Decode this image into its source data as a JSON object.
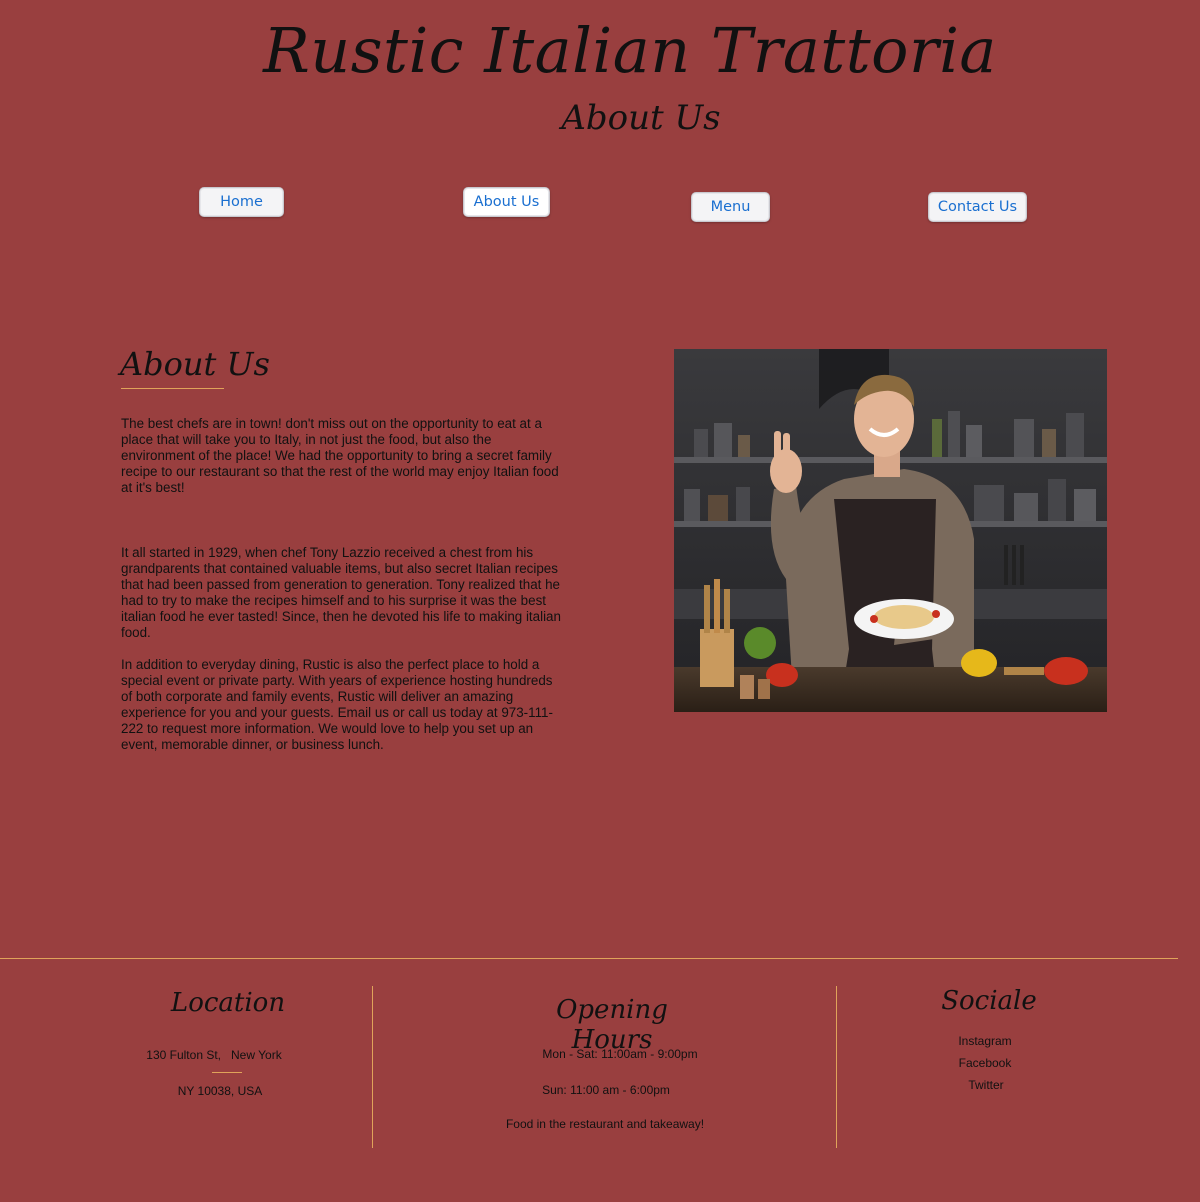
{
  "header": {
    "site_title": "Rustic Italian Trattoria",
    "page_subtitle": "About Us"
  },
  "nav": {
    "items": [
      {
        "label": "Home"
      },
      {
        "label": "About Us"
      },
      {
        "label": "Menu"
      },
      {
        "label": "Contact Us"
      }
    ]
  },
  "about": {
    "heading": "About Us",
    "paragraphs": [
      "The best chefs are in town! don't miss out on the opportunity to eat at a place that will take you to Italy, in not just the food, but also the environment of the place! We had the opportunity to bring a secret family recipe to our restaurant so that the rest of the world may enjoy Italian food at it's best!",
      "It all started in 1929, when chef Tony Lazzio received a chest from his grandparents that contained valuable items, but also secret Italian recipes that had been passed from generation to generation. Tony realized that he had to try to make the recipes himself and to his surprise it was the best italian food he ever tasted! Since, then he devoted his life to making italian food.",
      "In addition to everyday dining, Rustic is also the perfect place to hold a special event or private party. With years of experience hosting hundreds of both corporate and family events, Rustic will deliver an amazing experience for you and your guests. Email us or call us today at 973-111-222 to request more information. We would love to help you set up an event, memorable dinner, or business lunch."
    ]
  },
  "footer": {
    "location": {
      "heading": "Location",
      "street": "130 Fulton St,   New York",
      "city": "NY 10038, USA"
    },
    "hours": {
      "heading": "Opening Hours",
      "line1": "Mon - Sat: 11:00am - 9:00pm",
      "line2": "Sun: 11:00 am - 6:00pm",
      "line3": "Food in the restaurant and takeaway!"
    },
    "social": {
      "heading": "Sociale",
      "links": [
        {
          "label": "Instagram"
        },
        {
          "label": "Facebook"
        },
        {
          "label": "Twitter"
        }
      ]
    }
  },
  "colors": {
    "background": "#993f3f",
    "accent_line": "#e0a35a",
    "nav_text": "#1a6fd0"
  }
}
